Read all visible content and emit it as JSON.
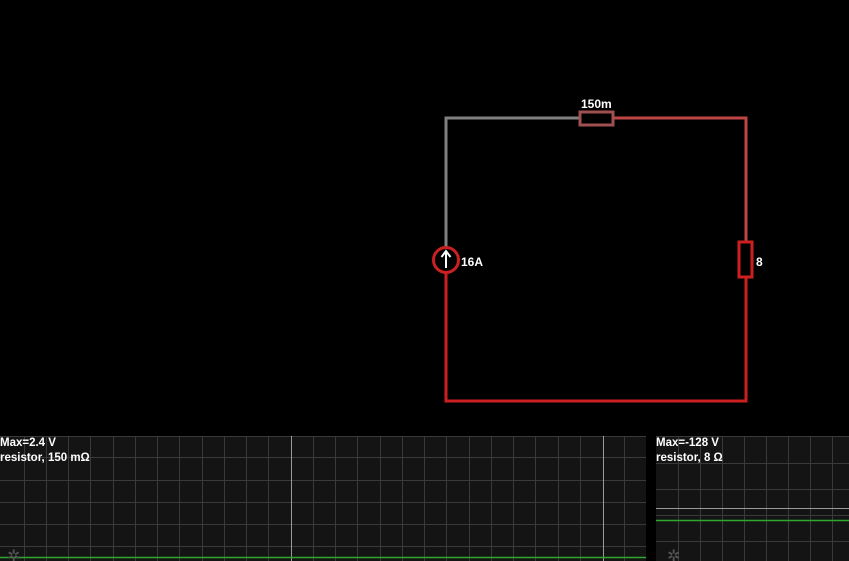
{
  "circuit": {
    "source_label": "16A",
    "r1_label": "150m",
    "r2_label": "8"
  },
  "colors": {
    "background": "#000000",
    "wire_neutral": "#808080",
    "wire_mid": "#c04545",
    "wire_hot": "#cc2020",
    "scope_bg": "#141414",
    "grid": "#3a3a3a",
    "trace": "#2fa82f"
  },
  "scopes": [
    {
      "max": "Max=2.4 V",
      "name": "resistor, 150 mΩ",
      "settings_icon": "gear-icon"
    },
    {
      "max": "Max=-128 V",
      "name": "resistor, 8 Ω",
      "settings_icon": "gear-icon"
    }
  ]
}
